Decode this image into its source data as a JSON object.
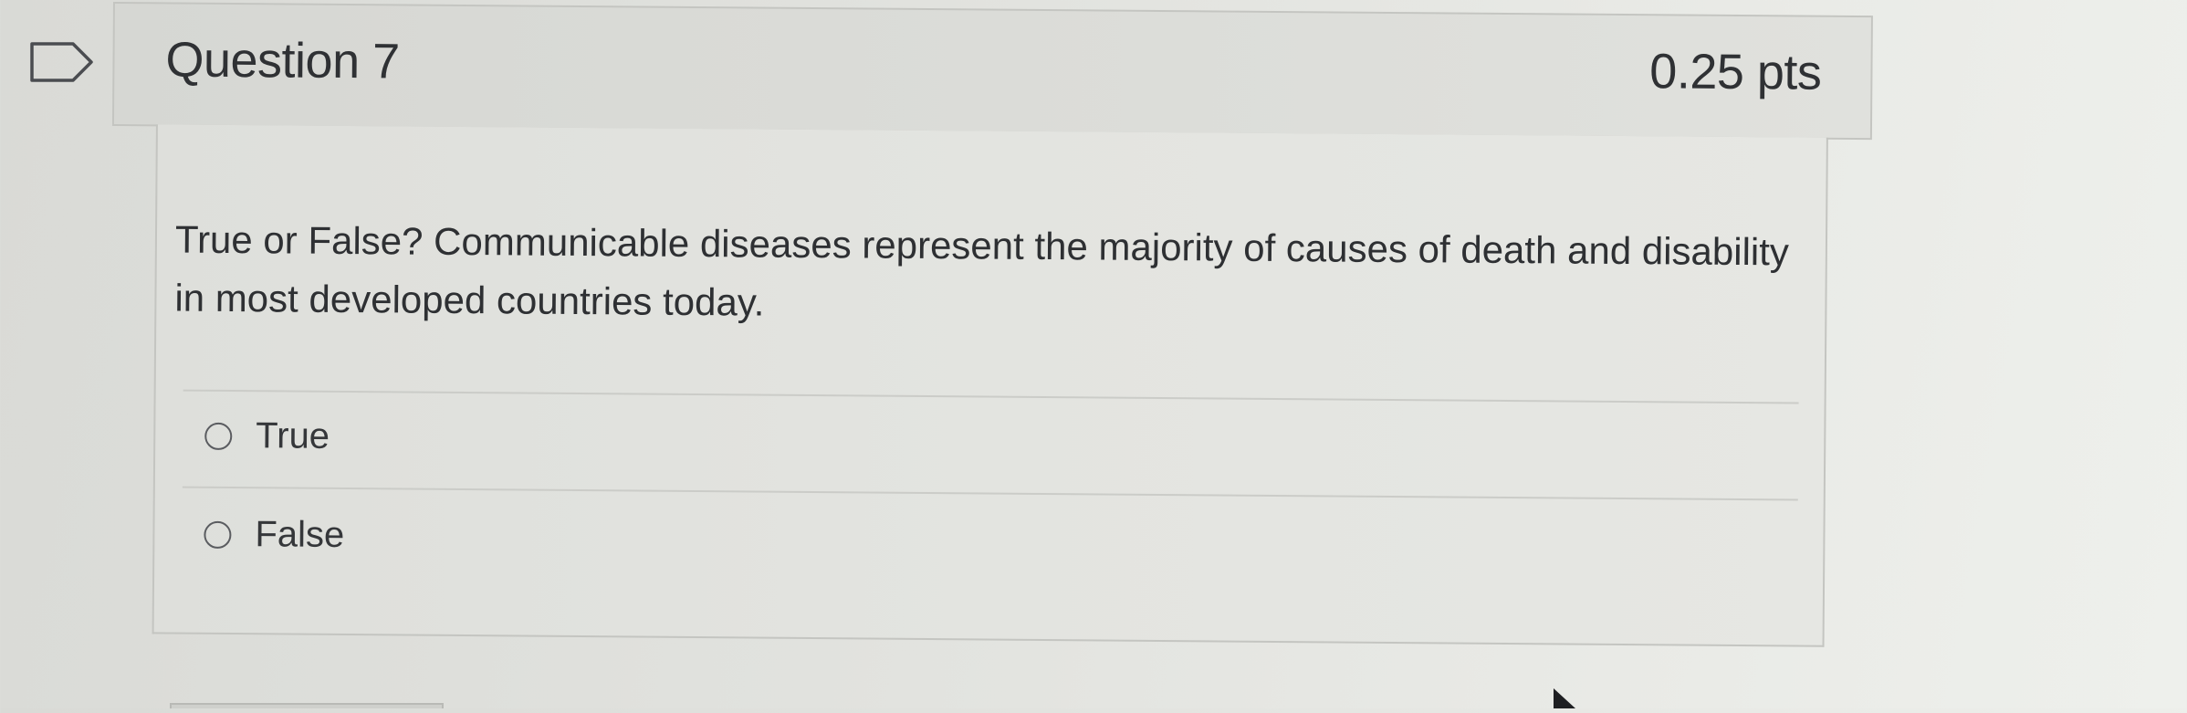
{
  "question": {
    "title": "Question 7",
    "points": "0.25 pts",
    "text": "True or False? Communicable diseases represent the majority of causes of death and disability in most developed countries today.",
    "bookmark_icon": "bookmark-flag-icon"
  },
  "answers": [
    {
      "label": "True",
      "selected": false
    },
    {
      "label": "False",
      "selected": false
    }
  ],
  "colors": {
    "text": "#2f3134",
    "border": "#c4c5c1",
    "header_bg": "#d9dad6",
    "body_bg": "#e3e4e0"
  }
}
